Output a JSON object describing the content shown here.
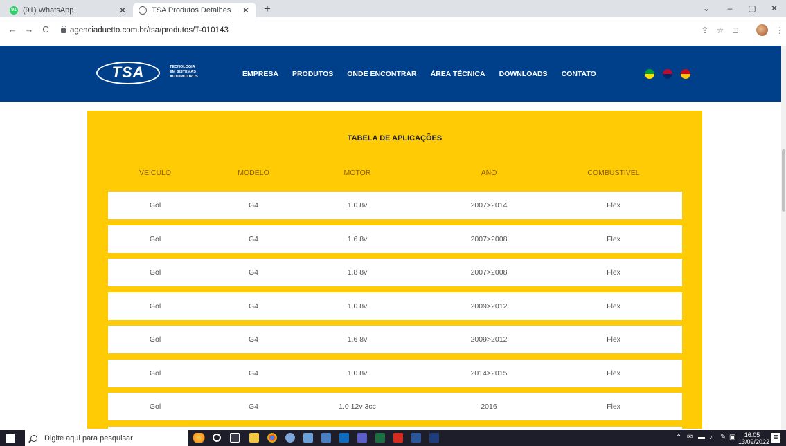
{
  "browser": {
    "tabs": [
      {
        "title": "(91) WhatsApp",
        "favicon": "whatsapp-icon",
        "badge": "91"
      },
      {
        "title": "TSA Produtos Detalhes",
        "favicon": "globe-icon"
      }
    ],
    "new_tab": "+",
    "window": {
      "minimize": "–",
      "maximize": "▢",
      "close": "✕",
      "dropdown": "⌄"
    },
    "nav": {
      "back": "←",
      "forward": "→",
      "reload": "C"
    },
    "url": "agenciaduetto.com.br/tsa/produtos/T-010143"
  },
  "site": {
    "logo_text": "TSA",
    "tagline": [
      "TECNOLOGIA",
      "EM SISTEMAS",
      "AUTOMOTIVOS"
    ],
    "nav": [
      "EMPRESA",
      "PRODUTOS",
      "ONDE ENCONTRAR",
      "ÁREA TÉCNICA",
      "DOWNLOADS",
      "CONTATO"
    ],
    "languages": [
      "flag-brazil-icon",
      "flag-usa-icon",
      "flag-spain-icon"
    ],
    "accent_color": "#ffcb05",
    "header_color": "#003f8a"
  },
  "table": {
    "title": "TABELA DE APLICAÇÕES",
    "headers": [
      "VEÍCULO",
      "MODELO",
      "MOTOR",
      "ANO",
      "COMBUSTÍVEL"
    ],
    "rows": [
      [
        "Gol",
        "G4",
        "1.0 8v",
        "2007>2014",
        "Flex"
      ],
      [
        "Gol",
        "G4",
        "1.6 8v",
        "2007>2008",
        "Flex"
      ],
      [
        "Gol",
        "G4",
        "1.8 8v",
        "2007>2008",
        "Flex"
      ],
      [
        "Gol",
        "G4",
        "1.0 8v",
        "2009>2012",
        "Flex"
      ],
      [
        "Gol",
        "G4",
        "1.6 8v",
        "2009>2012",
        "Flex"
      ],
      [
        "Gol",
        "G4",
        "1.0 8v",
        "2014>2015",
        "Flex"
      ],
      [
        "Gol",
        "G4",
        "1.0 12v 3cc",
        "2016",
        "Flex"
      ]
    ]
  },
  "taskbar": {
    "search_placeholder": "Digite aqui para pesquisar",
    "time": "16:05",
    "date": "13/09/2022"
  }
}
